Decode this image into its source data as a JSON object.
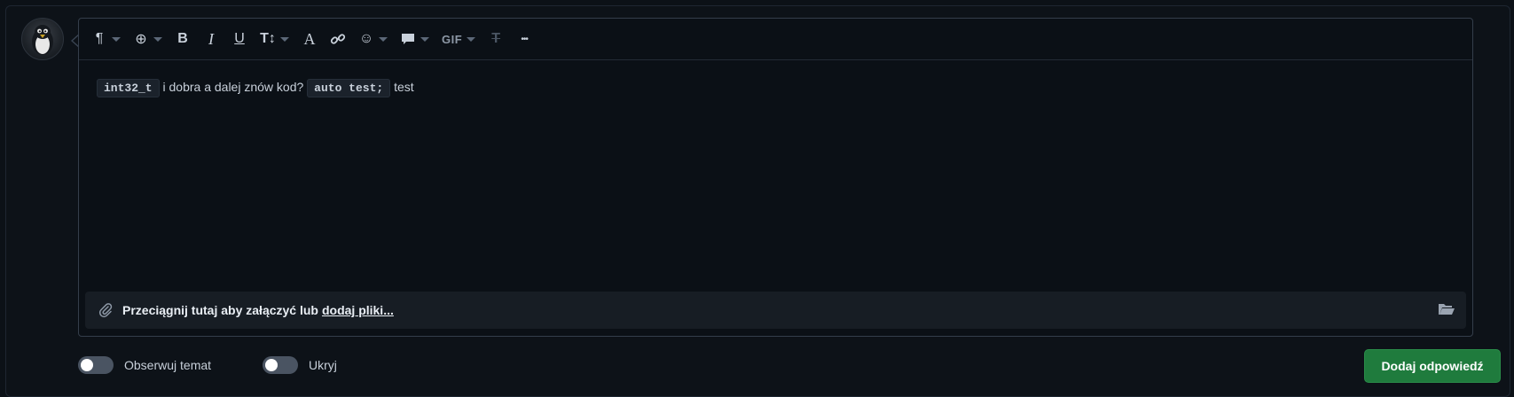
{
  "toolbar": {
    "items": [
      {
        "name": "paragraph",
        "glyph": "¶",
        "dropdown": true
      },
      {
        "name": "insert",
        "glyph": "⊕",
        "dropdown": true
      },
      {
        "name": "bold",
        "glyph": "B",
        "dropdown": false
      },
      {
        "name": "italic",
        "glyph": "I",
        "dropdown": false
      },
      {
        "name": "underline",
        "glyph": "U",
        "dropdown": false
      },
      {
        "name": "text-size",
        "glyph": "T↕",
        "dropdown": true
      },
      {
        "name": "text-color",
        "glyph": "A",
        "dropdown": false
      },
      {
        "name": "link",
        "glyph": "🔗",
        "dropdown": false
      },
      {
        "name": "emoji",
        "glyph": "☺",
        "dropdown": true
      },
      {
        "name": "comment",
        "glyph": "▭",
        "dropdown": true
      },
      {
        "name": "gif",
        "glyph": "GIF",
        "dropdown": true
      },
      {
        "name": "clear-format",
        "glyph": "T̶",
        "dropdown": false
      },
      {
        "name": "more",
        "glyph": "•••",
        "dropdown": false
      }
    ]
  },
  "content": {
    "code1": "int32_t",
    "text1": "i dobra a dalej znów kod?",
    "code2": "auto test;",
    "text2": "test"
  },
  "dropzone": {
    "label": "Przeciągnij tutaj aby załączyć lub",
    "link": "dodaj pliki..."
  },
  "toggles": {
    "watch_label": "Obserwuj temat",
    "hide_label": "Ukryj"
  },
  "submit_label": "Dodaj odpowiedź",
  "colors": {
    "background": "#0c1117",
    "submit": "#1f7b3d",
    "toggle_off": "#4a5462"
  }
}
